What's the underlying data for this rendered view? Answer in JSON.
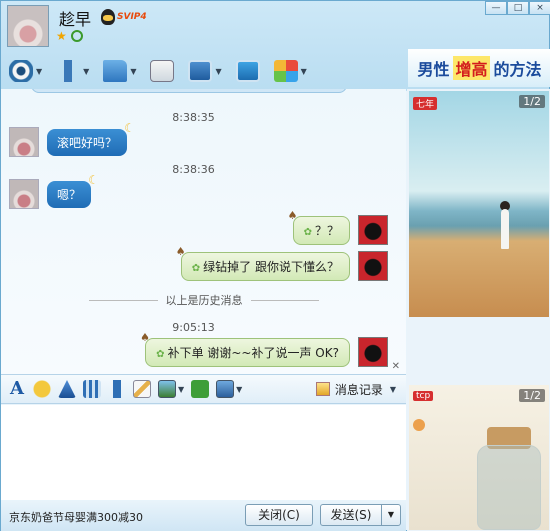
{
  "header": {
    "contact_name": "趁早",
    "vip_label": "SVIP4",
    "window_controls": [
      "—",
      "□",
      "×"
    ]
  },
  "toolbar": {
    "items": [
      {
        "icon": "webcam-icon"
      },
      {
        "icon": "microphone-icon"
      },
      {
        "icon": "file-transfer-icon"
      },
      {
        "icon": "send-sms-icon"
      },
      {
        "icon": "remote-desktop-icon"
      },
      {
        "icon": "share-screen-icon"
      },
      {
        "icon": "apps-icon"
      }
    ]
  },
  "ad": {
    "text_part1": "男性",
    "text_highlight": "增高",
    "text_part2": "的方法"
  },
  "chat": {
    "messages": [
      {
        "type": "time",
        "text": "8:38:35"
      },
      {
        "type": "in",
        "text": "滚吧好吗？"
      },
      {
        "type": "time",
        "text": "8:38:36"
      },
      {
        "type": "in",
        "text": "嗯？"
      },
      {
        "type": "out",
        "text": "？？"
      },
      {
        "type": "out",
        "text": "绿钻掉了 跟你说下懂么？"
      },
      {
        "type": "divider",
        "text": "以上是历史消息"
      },
      {
        "type": "time",
        "text": "9:05:13"
      },
      {
        "type": "out",
        "text": "补下单 谢谢~~补了说一声 OK?"
      }
    ]
  },
  "input_toolbar": {
    "font_label": "A",
    "history_label": "消息记录"
  },
  "bottom": {
    "promo": "京东奶爸节母婴满300减30",
    "close_label": "关闭(C)",
    "send_label": "发送(S)"
  },
  "right_panel": {
    "photo1_page": "1/2",
    "photo1_tag": "七年",
    "photo2_page": "1/2",
    "photo2_tag": "tcp"
  },
  "colors": {
    "accent_blue": "#1f6cb5",
    "bubble_green": "#d2e9b6",
    "window_border": "#6aa9cf"
  }
}
